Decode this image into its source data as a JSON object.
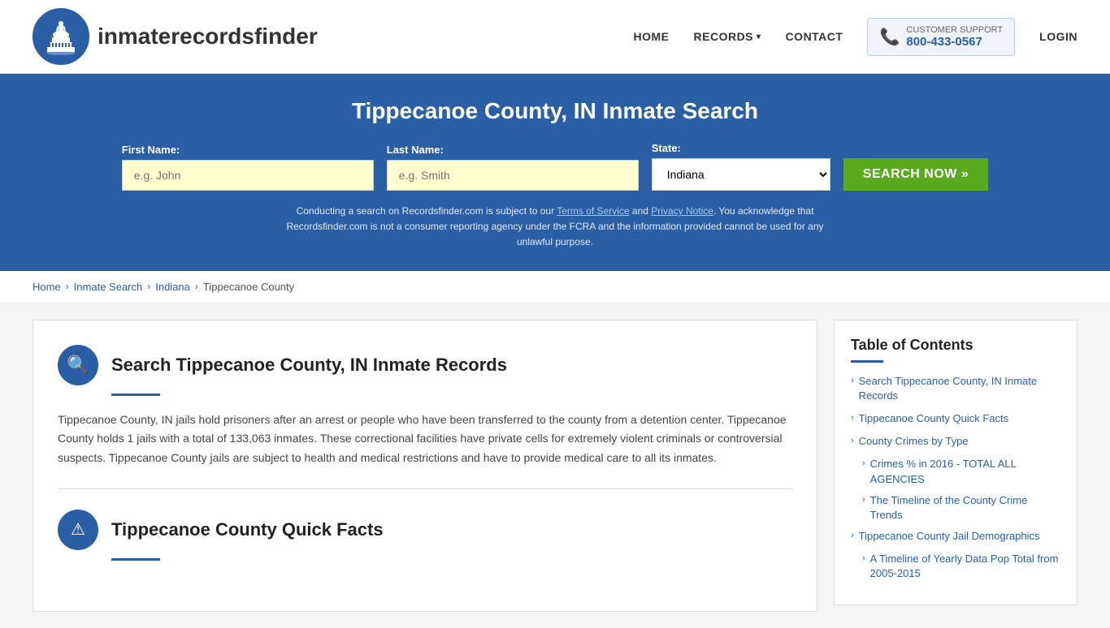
{
  "header": {
    "logo_text_main": "inmaterecords",
    "logo_text_bold": "finder",
    "nav": {
      "home": "HOME",
      "records": "RECORDS",
      "contact": "CONTACT",
      "support_label": "CUSTOMER SUPPORT",
      "support_number": "800-433-0567",
      "login": "LOGIN"
    }
  },
  "hero": {
    "title": "Tippecanoe County, IN Inmate Search",
    "form": {
      "first_name_label": "First Name:",
      "first_name_placeholder": "e.g. John",
      "last_name_label": "Last Name:",
      "last_name_placeholder": "e.g. Smith",
      "state_label": "State:",
      "state_value": "Indiana",
      "search_button": "SEARCH NOW »"
    },
    "disclaimer": "Conducting a search on Recordsfinder.com is subject to our Terms of Service and Privacy Notice. You acknowledge that Recordsfinder.com is not a consumer reporting agency under the FCRA and the information provided cannot be used for any unlawful purpose."
  },
  "breadcrumb": {
    "items": [
      "Home",
      "Inmate Search",
      "Indiana",
      "Tippecanoe County"
    ]
  },
  "article": {
    "section1": {
      "icon": "🔍",
      "title": "Search Tippecanoe County, IN Inmate Records",
      "body": "Tippecanoe County, IN jails hold prisoners after an arrest or people who have been transferred to the county from a detention center. Tippecanoe County holds 1 jails with a total of 133,063 inmates. These correctional facilities have private cells for extremely violent criminals or controversial suspects. Tippecanoe County jails are subject to health and medical restrictions and have to provide medical care to all its inmates."
    },
    "section2": {
      "icon": "⚠",
      "title": "Tippecanoe County Quick Facts"
    }
  },
  "toc": {
    "title": "Table of Contents",
    "items": [
      {
        "label": "Search Tippecanoe County, IN Inmate Records",
        "sub": false
      },
      {
        "label": "Tippecanoe County Quick Facts",
        "sub": false
      },
      {
        "label": "County Crimes by Type",
        "sub": false
      },
      {
        "label": "Crimes % in 2016 - TOTAL ALL AGENCIES",
        "sub": true
      },
      {
        "label": "The Timeline of the County Crime Trends",
        "sub": true
      },
      {
        "label": "Tippecanoe County Jail Demographics",
        "sub": false
      },
      {
        "label": "A Timeline of Yearly Data Pop Total from 2005-2015",
        "sub": true
      }
    ]
  }
}
